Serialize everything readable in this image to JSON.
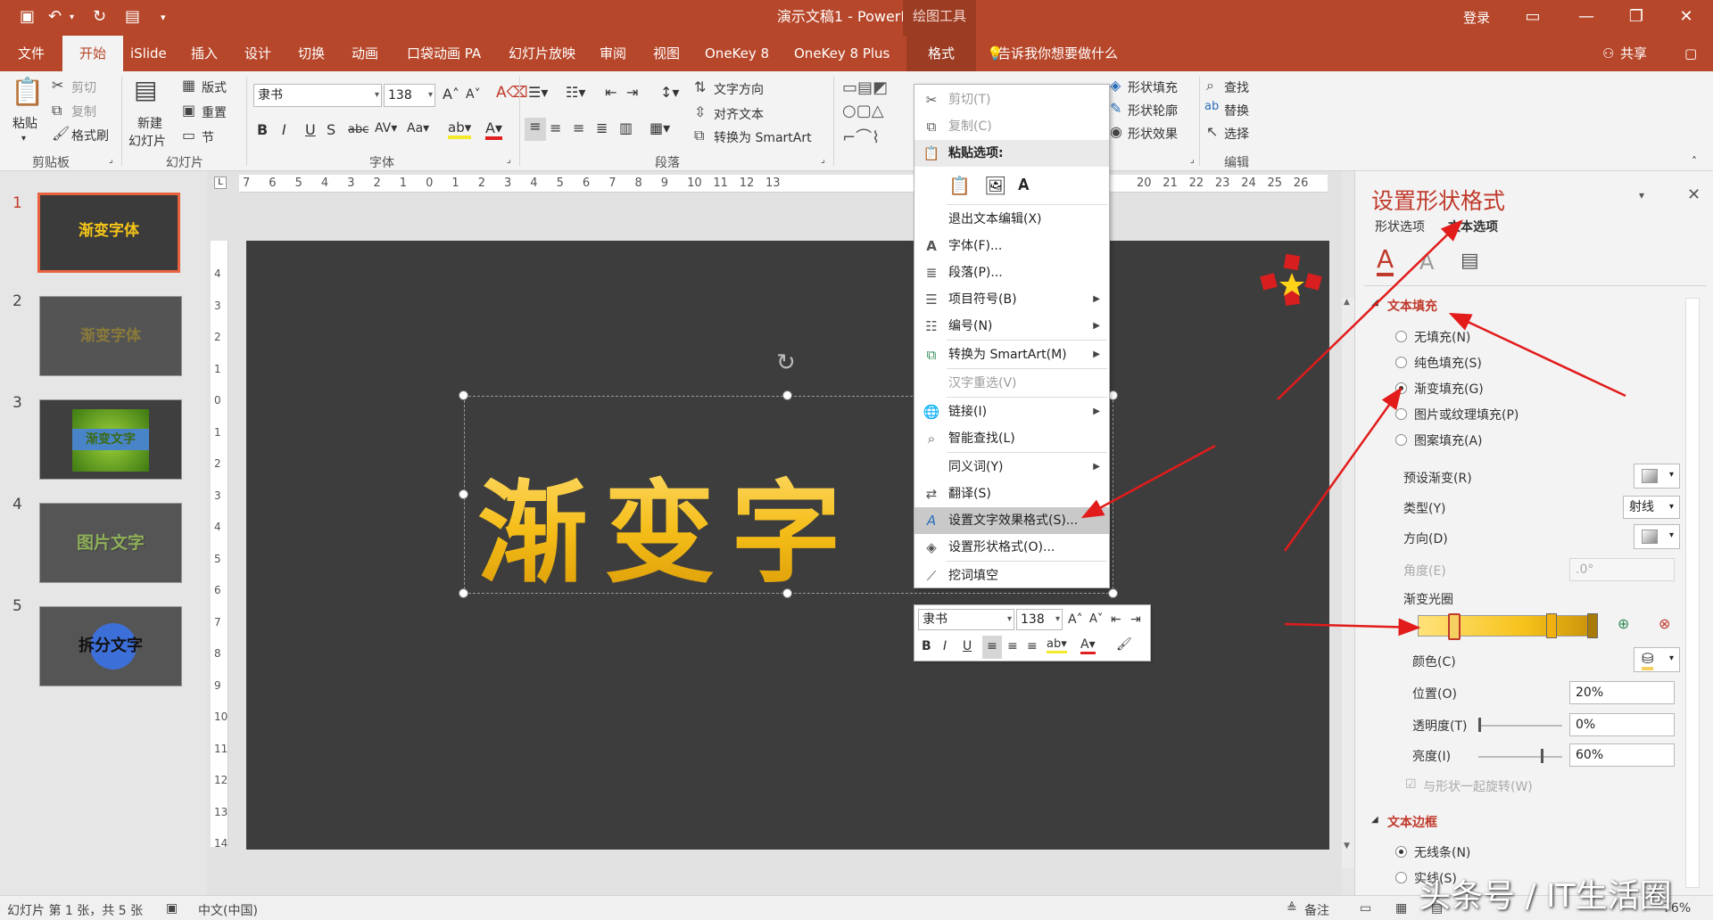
{
  "window": {
    "title": "演示文稿1  -  PowerPoint",
    "login": "登录",
    "context_tools": "绘图工具",
    "share": "共享"
  },
  "tabs": [
    "文件",
    "开始",
    "iSlide",
    "插入",
    "设计",
    "切换",
    "动画",
    "口袋动画 PA",
    "幻灯片放映",
    "审阅",
    "视图",
    "OneKey 8",
    "OneKey 8 Plus",
    "格式"
  ],
  "tellme": "告诉我你想要做什么",
  "ribbon": {
    "paste": "粘贴",
    "cut": "剪切",
    "copy": "复制",
    "format_painter": "格式刷",
    "new_slide": "新建",
    "new_slide2": "幻灯片",
    "layout": "版式",
    "reset": "重置",
    "section": "节",
    "font_name": "隶书",
    "font_size": "138",
    "text_direction": "文字方向",
    "align_text": "对齐文本",
    "smartart": "转换为 SmartArt",
    "shape_fill": "形状填充",
    "shape_outline": "形状轮廓",
    "shape_effect": "形状效果",
    "find": "查找",
    "replace": "替换",
    "select": "选择",
    "groups": {
      "clipboard": "剪贴板",
      "slides": "幻灯片",
      "font": "字体",
      "paragraph": "段落",
      "edit": "编辑"
    }
  },
  "ruler_h": [
    "7",
    "6",
    "5",
    "4",
    "3",
    "2",
    "1",
    "0",
    "1",
    "2",
    "3",
    "4",
    "5",
    "6",
    "7",
    "8",
    "9",
    "10",
    "11",
    "12",
    "13"
  ],
  "ruler_h_right": [
    "20",
    "21",
    "22",
    "23",
    "24",
    "25",
    "26"
  ],
  "ruler_v": [
    "4",
    "3",
    "2",
    "1",
    "0",
    "1",
    "2",
    "3",
    "4",
    "5",
    "6",
    "7",
    "8",
    "9",
    "10",
    "11",
    "12",
    "13",
    "14"
  ],
  "slides": [
    {
      "num": "1",
      "text": "渐变字体"
    },
    {
      "num": "2",
      "text": "渐变字体"
    },
    {
      "num": "3",
      "text": "渐变文字"
    },
    {
      "num": "4",
      "text": "图片文字"
    },
    {
      "num": "5",
      "text": "拆分文字"
    }
  ],
  "slide_text": "渐变字",
  "context_menu": {
    "cut": "剪切(T)",
    "copy": "复制(C)",
    "paste_options": "粘贴选项:",
    "exit_edit": "退出文本编辑(X)",
    "font": "字体(F)...",
    "paragraph": "段落(P)...",
    "bullets": "项目符号(B)",
    "numbering": "编号(N)",
    "smartart": "转换为 SmartArt(M)",
    "reconvert": "汉字重选(V)",
    "link": "链接(I)",
    "smart_lookup": "智能查找(L)",
    "synonyms": "同义词(Y)",
    "translate": "翻译(S)",
    "text_effects": "设置文字效果格式(S)...",
    "shape_format": "设置形状格式(O)...",
    "cloze": "挖词填空"
  },
  "mini_toolbar": {
    "font": "隶书",
    "size": "138"
  },
  "pane": {
    "title": "设置形状格式",
    "tab_shape": "形状选项",
    "tab_text": "文本选项",
    "section_fill": "文本填充",
    "options": [
      "无填充(N)",
      "纯色填充(S)",
      "渐变填充(G)",
      "图片或纹理填充(P)",
      "图案填充(A)"
    ],
    "preset": "预设渐变(R)",
    "type": "类型(Y)",
    "type_value": "射线",
    "direction": "方向(D)",
    "angle": "角度(E)",
    "angle_value": ".0°",
    "stops": "渐变光圈",
    "color": "颜色(C)",
    "position": "位置(O)",
    "position_value": "20%",
    "transparency": "透明度(T)",
    "transparency_value": "0%",
    "brightness": "亮度(I)",
    "brightness_value": "60%",
    "rotate_with_shape": "与形状一起旋转(W)",
    "section_border": "文本边框",
    "no_line": "无线条(N)",
    "solid_line": "实线(S)"
  },
  "status": {
    "slide_info": "幻灯片 第 1 张，共 5 张",
    "language": "中文(中国)",
    "notes": "备注",
    "zoom": "76%"
  },
  "watermark": "头条号 / IT生活圈",
  "colors": {
    "accent": "#b7472a",
    "slide_bg": "#3d3d3d",
    "text_gold": "#f5bd18",
    "highlight": "#c0392b"
  }
}
